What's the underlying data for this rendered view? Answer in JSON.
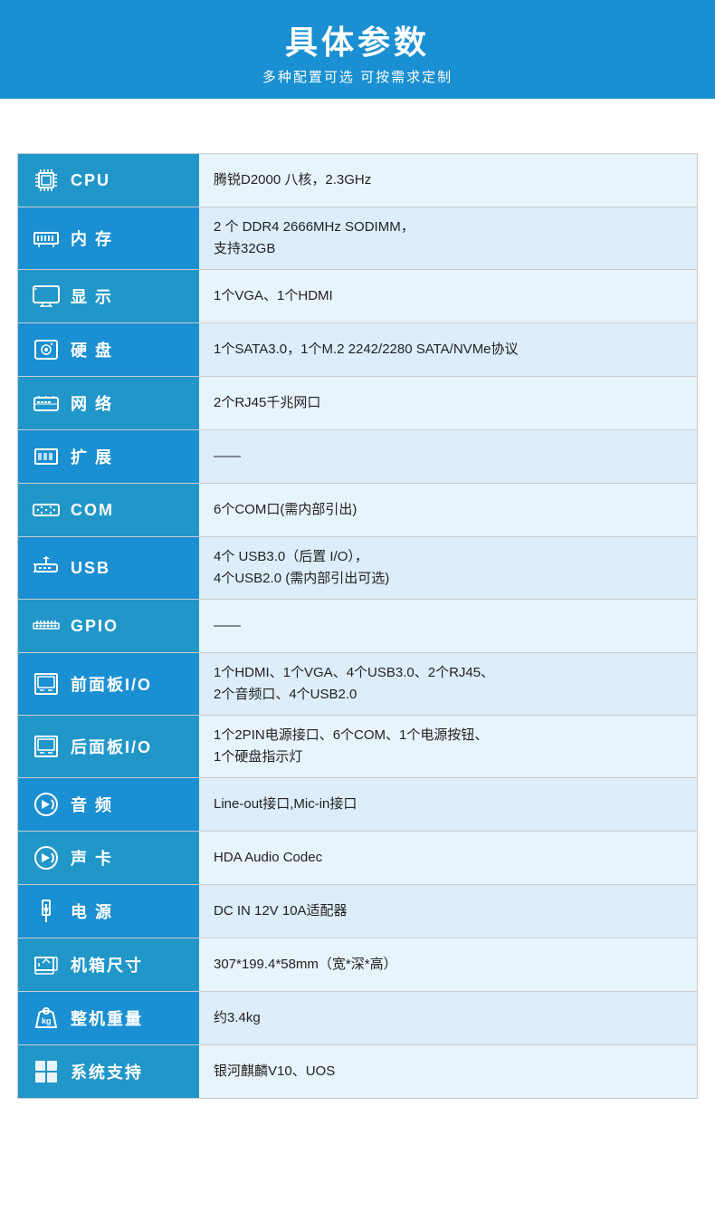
{
  "header": {
    "title": "具体参数",
    "subtitle": "多种配置可选 可按需求定制"
  },
  "rows": [
    {
      "id": "cpu",
      "icon": "cpu",
      "label": "CPU",
      "value": "腾锐D2000 八核，2.3GHz"
    },
    {
      "id": "memory",
      "icon": "memory",
      "label": "内 存",
      "value": "2 个 DDR4 2666MHz SODIMM，\n支持32GB"
    },
    {
      "id": "display",
      "icon": "display",
      "label": "显 示",
      "value": "1个VGA、1个HDMI"
    },
    {
      "id": "hdd",
      "icon": "hdd",
      "label": "硬 盘",
      "value": "1个SATA3.0，1个M.2 2242/2280 SATA/NVMe协议"
    },
    {
      "id": "network",
      "icon": "network",
      "label": "网 络",
      "value": "2个RJ45千兆网口"
    },
    {
      "id": "expand",
      "icon": "expand",
      "label": "扩 展",
      "value": "——"
    },
    {
      "id": "com",
      "icon": "com",
      "label": "COM",
      "value": "6个COM口(需内部引出)"
    },
    {
      "id": "usb",
      "icon": "usb",
      "label": "USB",
      "value": "4个 USB3.0（后置 I/O），\n4个USB2.0 (需内部引出可选)"
    },
    {
      "id": "gpio",
      "icon": "gpio",
      "label": "GPIO",
      "value": "——"
    },
    {
      "id": "front-io",
      "icon": "panel",
      "label": "前面板I/O",
      "value": "1个HDMI、1个VGA、4个USB3.0、2个RJ45、\n2个音频口、4个USB2.0"
    },
    {
      "id": "rear-io",
      "icon": "panel",
      "label": "后面板I/O",
      "value": "1个2PIN电源接口、6个COM、1个电源按钮、\n1个硬盘指示灯"
    },
    {
      "id": "audio",
      "icon": "audio",
      "label": "音 频",
      "value": "Line-out接口,Mic-in接口"
    },
    {
      "id": "soundcard",
      "icon": "audio",
      "label": "声 卡",
      "value": "HDA Audio Codec"
    },
    {
      "id": "power",
      "icon": "power",
      "label": "电 源",
      "value": "DC IN 12V 10A适配器"
    },
    {
      "id": "dimensions",
      "icon": "dimensions",
      "label": "机箱尺寸",
      "value": "307*199.4*58mm（宽*深*高）"
    },
    {
      "id": "weight",
      "icon": "weight",
      "label": "整机重量",
      "value": "约3.4kg"
    },
    {
      "id": "os",
      "icon": "os",
      "label": "系统支持",
      "value": "银河麒麟V10、UOS"
    }
  ]
}
